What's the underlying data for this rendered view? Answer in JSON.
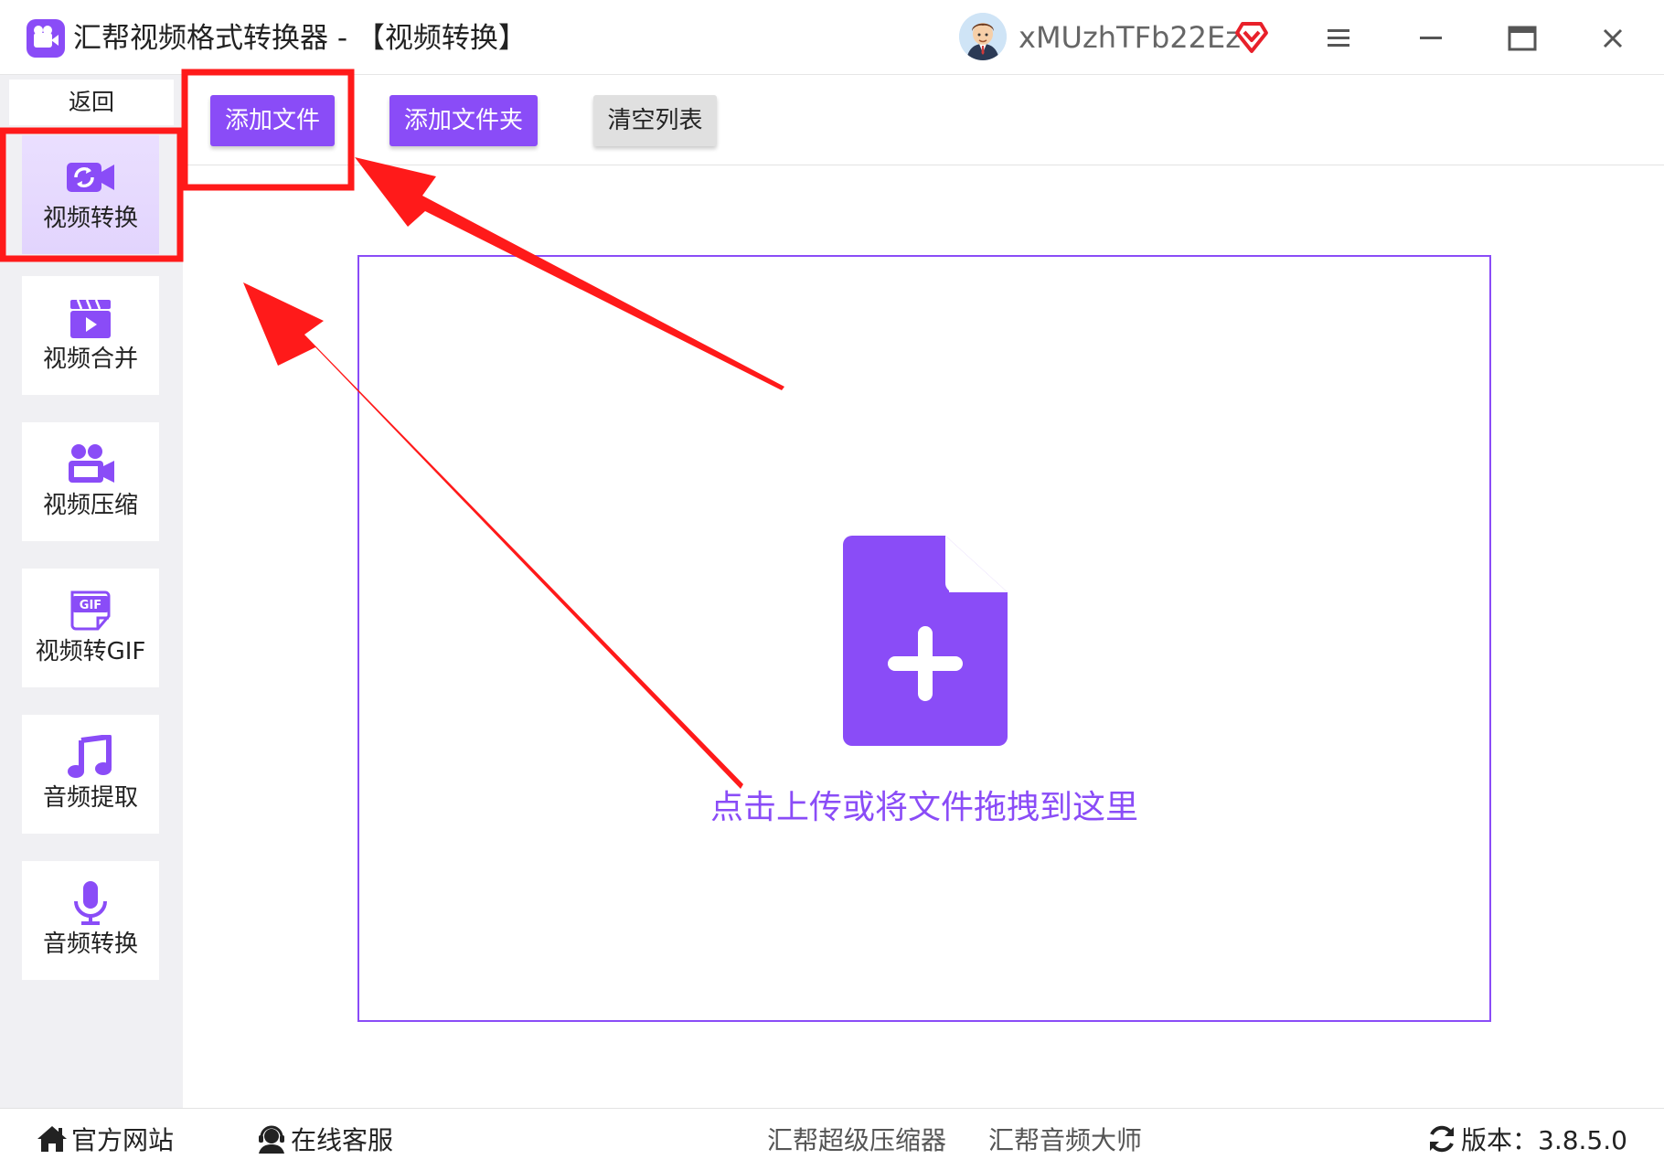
{
  "window": {
    "app_title": "汇帮视频格式转换器  -  【视频转换】",
    "username": "xMUzhTFb22Ez"
  },
  "sidebar": {
    "back_label": "返回",
    "items": [
      {
        "label": "视频转换",
        "icon": "video-convert-icon",
        "active": true
      },
      {
        "label": "视频合并",
        "icon": "video-merge-icon"
      },
      {
        "label": "视频压缩",
        "icon": "video-compress-icon"
      },
      {
        "label": "视频转GIF",
        "icon": "gif-icon"
      },
      {
        "label": "音频提取",
        "icon": "music-note-icon"
      },
      {
        "label": "音频转换",
        "icon": "microphone-icon"
      }
    ]
  },
  "toolbar": {
    "add_file": "添加文件",
    "add_folder": "添加文件夹",
    "clear_list": "清空列表"
  },
  "dropzone": {
    "text": "点击上传或将文件拖拽到这里"
  },
  "footer": {
    "website": "官方网站",
    "support": "在线客服",
    "link1": "汇帮超级压缩器",
    "link2": "汇帮音频大师",
    "version": "版本：3.8.5.0"
  },
  "colors": {
    "accent": "#8a4cf7",
    "annotation_red": "#ff1a1a"
  }
}
